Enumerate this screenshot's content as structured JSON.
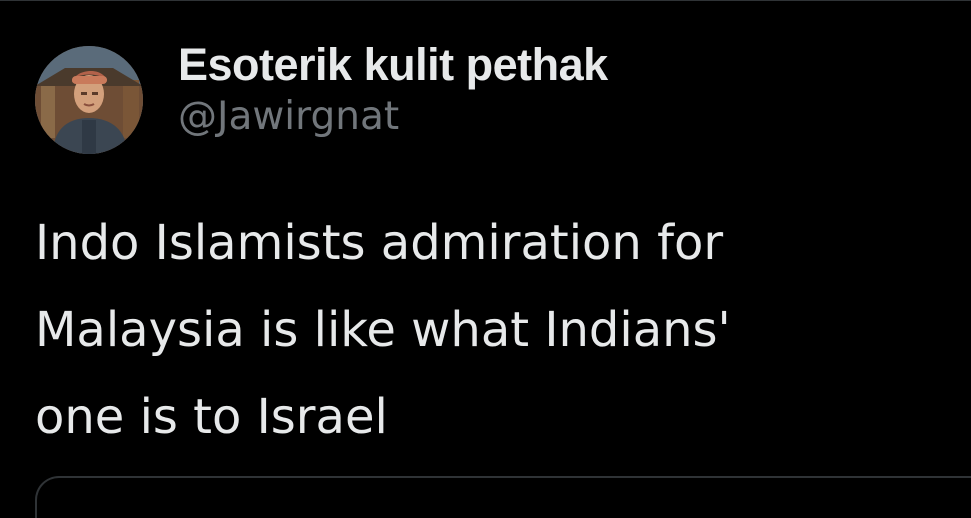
{
  "tweet": {
    "author": {
      "display_name": "Esoterik kulit pethak",
      "handle": "@Jawirgnat",
      "avatar_icon": "profile-photo"
    },
    "text_lines": [
      "Indo Islamists admiration for",
      "Malaysia is like what Indians'",
      "one is to Israel"
    ]
  },
  "colors": {
    "background": "#000000",
    "primary_text": "#e7e9ea",
    "secondary_text": "#71767b",
    "border": "#2f3336"
  }
}
